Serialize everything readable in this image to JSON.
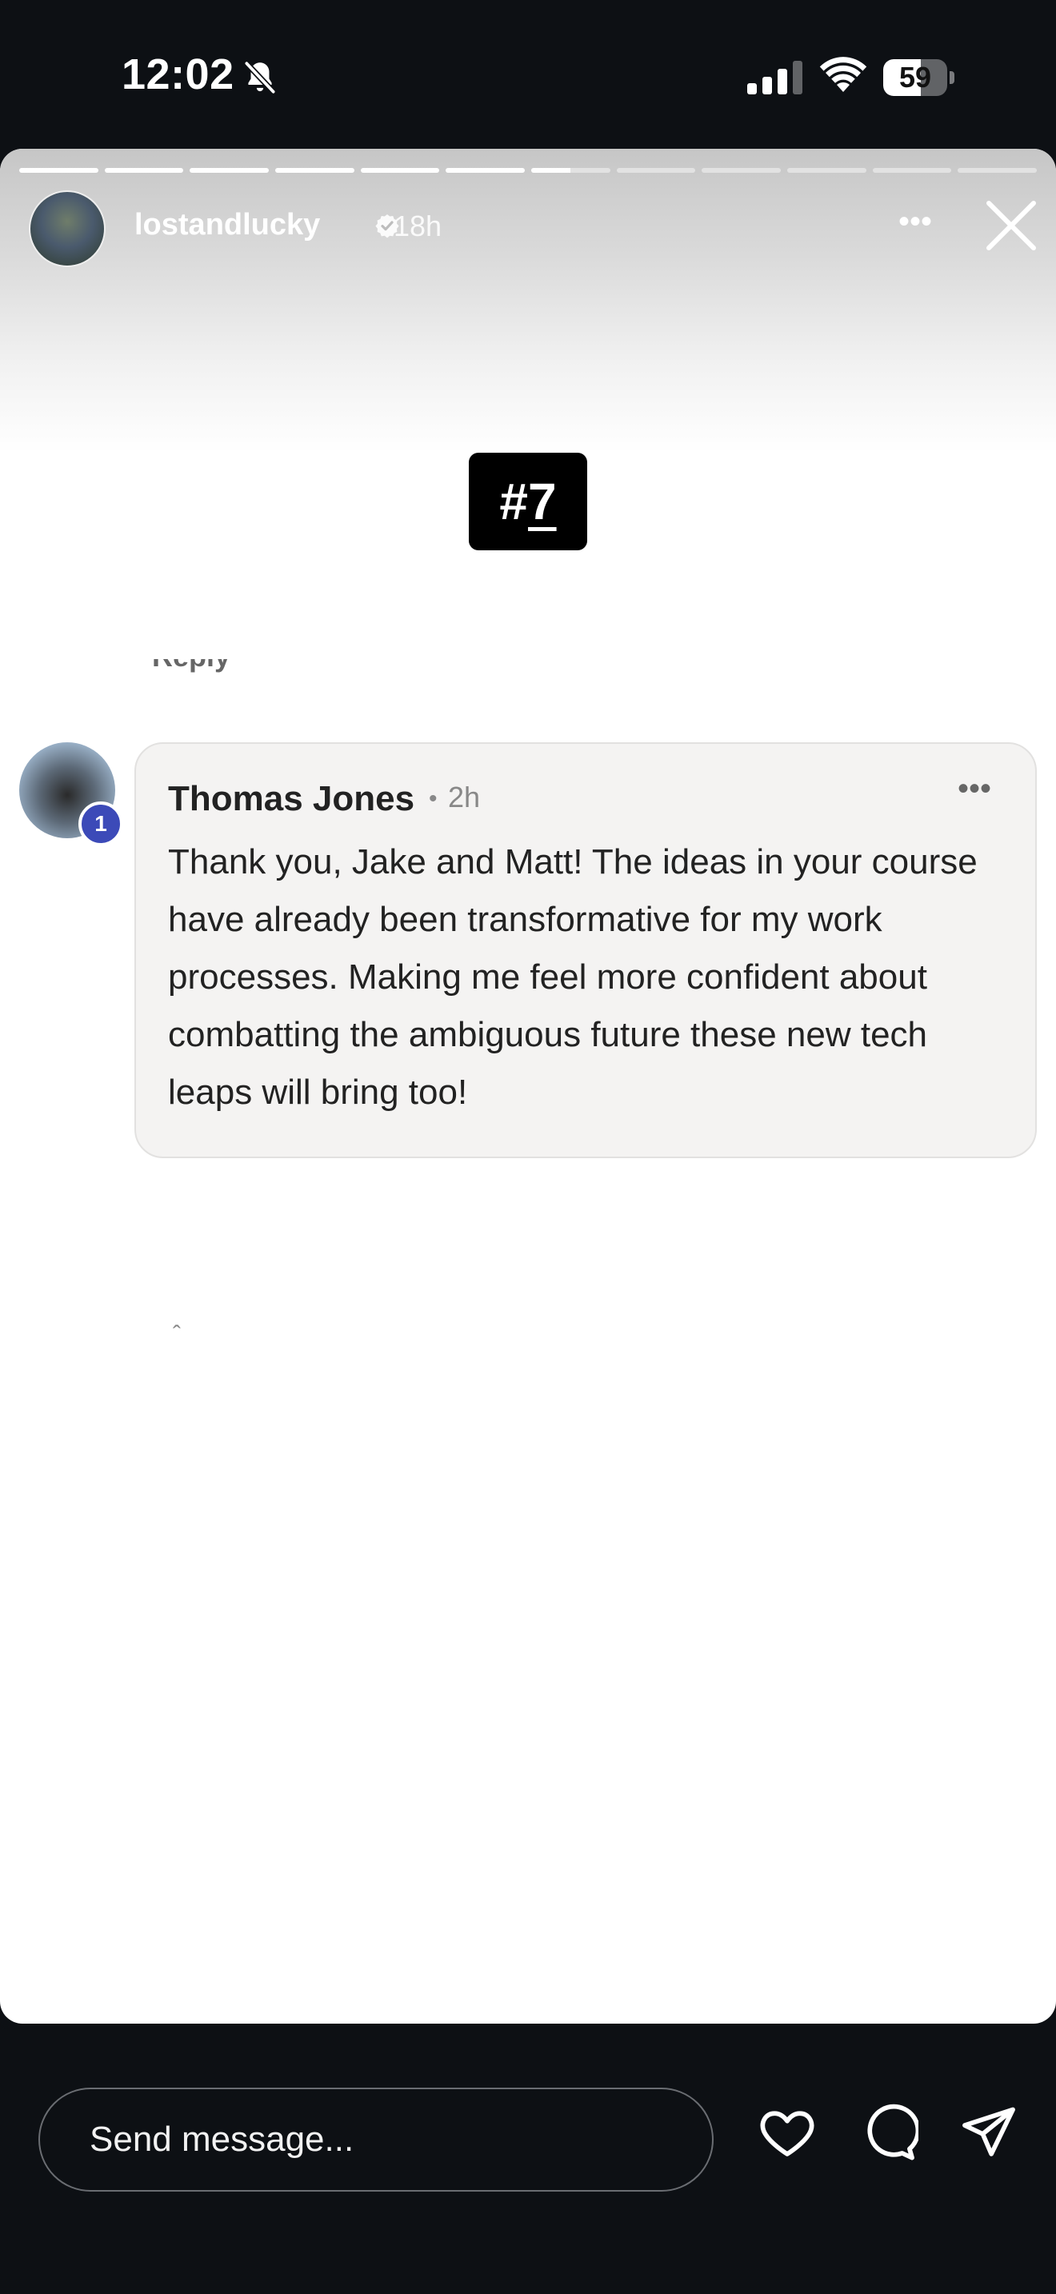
{
  "status_bar": {
    "time": "12:02",
    "silent_mode": true,
    "battery_level": "59",
    "battery_percent": 59
  },
  "story": {
    "username": "lostandlucky",
    "verified": true,
    "posted_ago": "18h",
    "progress": {
      "segments_total": 12,
      "segments_seen": 6,
      "current_segment_fraction": 0.5
    },
    "sticker_prefix": "#",
    "sticker_number": "7",
    "partial_row_text": "Reply",
    "comment": {
      "author": "Thomas Jones",
      "separator": "•",
      "time_ago": "2h",
      "rank_badge": "1",
      "text": "Thank you, Jake and Matt! The ideas in your course have already been transformative for my work processes. Making me feel more confident about combatting the ambiguous future these new tech leaps will bring too!",
      "caret": "ˆ"
    }
  },
  "composer": {
    "placeholder": "Send message..."
  },
  "icons": {
    "bell": "bell-slash-icon",
    "signal": "cellular-signal-icon",
    "wifi": "wifi-icon",
    "battery": "battery-icon",
    "verified": "verified-badge-icon",
    "more": "more-horizontal-icon",
    "close": "close-icon",
    "like": "heart-icon",
    "comment": "comment-bubble-icon",
    "share": "paper-plane-icon"
  }
}
